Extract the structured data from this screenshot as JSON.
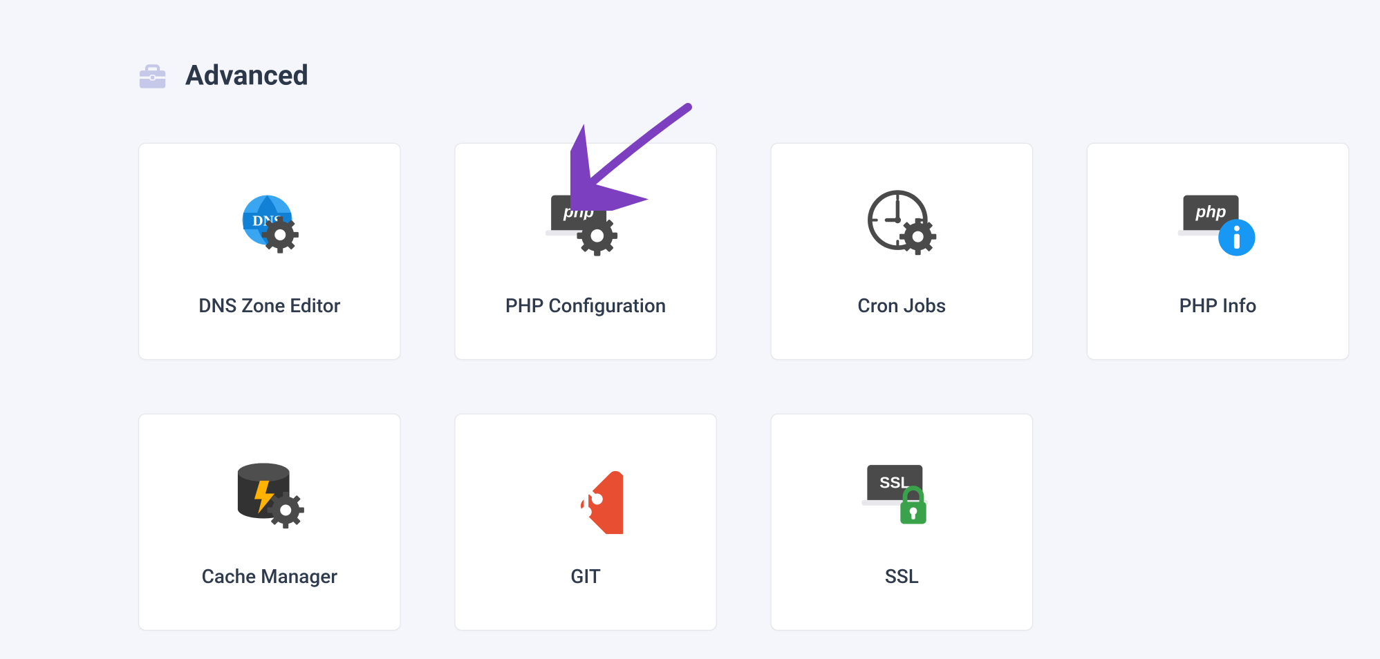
{
  "section": {
    "title": "Advanced"
  },
  "cards": [
    {
      "label": "DNS Zone Editor"
    },
    {
      "label": "PHP Configuration"
    },
    {
      "label": "Cron Jobs"
    },
    {
      "label": "PHP Info"
    },
    {
      "label": "Cache Manager"
    },
    {
      "label": "GIT"
    },
    {
      "label": "SSL"
    }
  ]
}
